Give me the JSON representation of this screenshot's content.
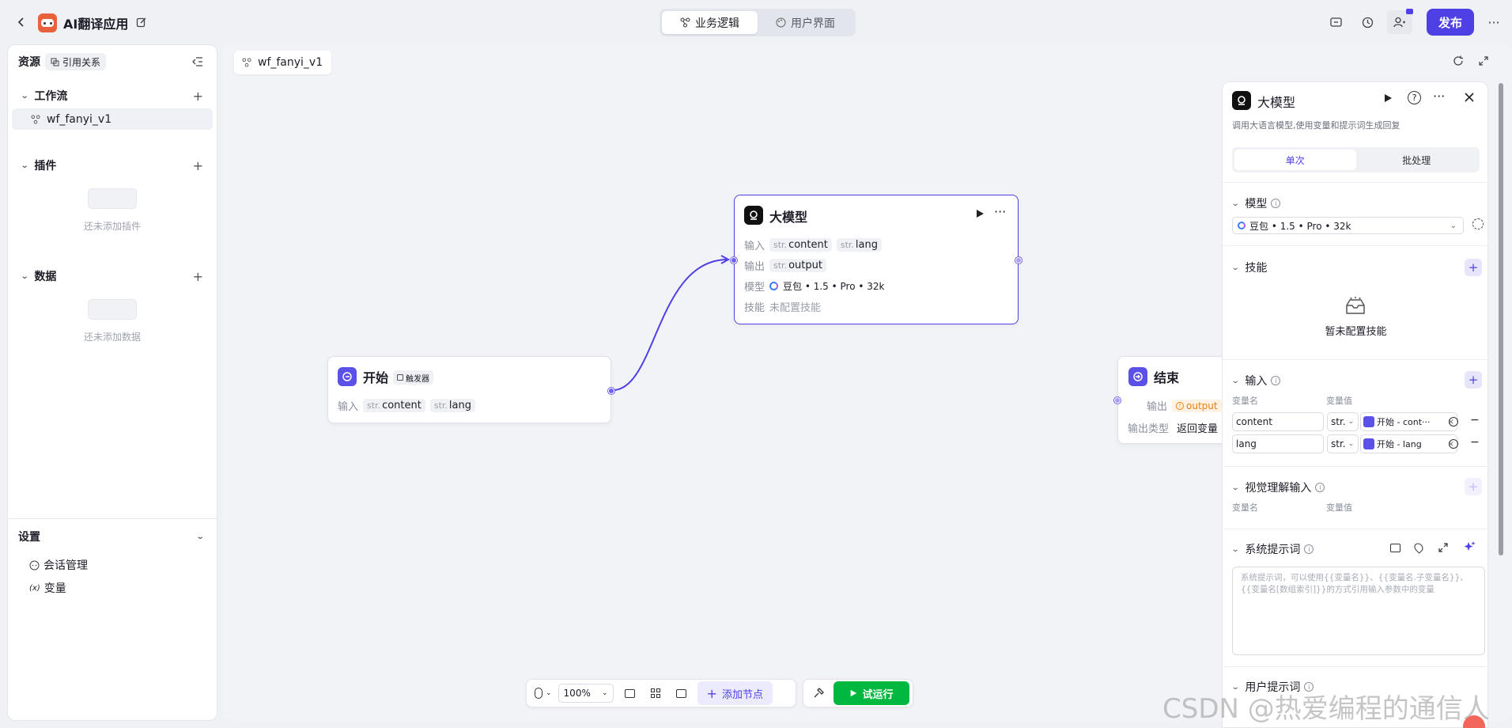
{
  "app": {
    "title": "AI翻译应用"
  },
  "top_tabs": [
    {
      "label": "业务逻辑",
      "active": true
    },
    {
      "label": "用户界面",
      "active": false
    }
  ],
  "publish_label": "发布",
  "left": {
    "resources_label": "资源",
    "refs_label": "引用关系",
    "workflow": {
      "title": "工作流",
      "items": [
        "wf_fanyi_v1"
      ]
    },
    "plugins": {
      "title": "插件",
      "empty": "还未添加插件"
    },
    "data": {
      "title": "数据",
      "empty": "还未添加数据"
    },
    "settings": {
      "title": "设置",
      "items": [
        "会话管理",
        "变量"
      ]
    }
  },
  "canvas_tab": "wf_fanyi_v1",
  "nodes": {
    "start": {
      "title": "开始",
      "badge": "触发器",
      "input_label": "输入",
      "inputs": [
        {
          "type": "str.",
          "name": "content"
        },
        {
          "type": "str.",
          "name": "lang"
        }
      ]
    },
    "llm": {
      "title": "大模型",
      "input_label": "输入",
      "inputs": [
        {
          "type": "str.",
          "name": "content"
        },
        {
          "type": "str.",
          "name": "lang"
        }
      ],
      "output_label": "输出",
      "outputs": [
        {
          "type": "str.",
          "name": "output"
        }
      ],
      "model_label": "模型",
      "model_value": "豆包 • 1.5 • Pro • 32k",
      "skill_label": "技能",
      "skill_value": "未配置技能"
    },
    "end": {
      "title": "结束",
      "output_label": "输出",
      "output_value": "output",
      "output_type_label": "输出类型",
      "output_type_value": "返回变量"
    }
  },
  "panel": {
    "title": "大模型",
    "desc": "调用大语言模型,使用变量和提示词生成回复",
    "tabs": [
      {
        "label": "单次",
        "active": true
      },
      {
        "label": "批处理",
        "active": false
      }
    ],
    "model": {
      "title": "模型",
      "value": "豆包 • 1.5 • Pro • 32k"
    },
    "skills": {
      "title": "技能",
      "empty": "暂未配置技能"
    },
    "inputs": {
      "title": "输入",
      "col_name": "变量名",
      "col_value": "变量值",
      "rows": [
        {
          "name": "content",
          "type": "str.",
          "ref": "开始 - cont···"
        },
        {
          "name": "lang",
          "type": "str.",
          "ref": "开始 - lang"
        }
      ]
    },
    "vision": {
      "title": "视觉理解输入",
      "col_name": "变量名",
      "col_value": "变量值"
    },
    "system_prompt": {
      "title": "系统提示词",
      "placeholder": "系统提示词，可以使用{{变量名}}、{{变量名.子变量名}}、{{变量名[数组索引]}}的方式引用输入参数中的变量"
    },
    "user_prompt": {
      "title": "用户提示词"
    }
  },
  "toolbar": {
    "zoom": "100%",
    "add_node": "添加节点",
    "run": "试运行"
  },
  "watermark": "CSDN @热爱编程的通信人",
  "colors": {
    "accent": "#4e40e5",
    "run": "#00b83f",
    "orange": "#f0800a"
  }
}
